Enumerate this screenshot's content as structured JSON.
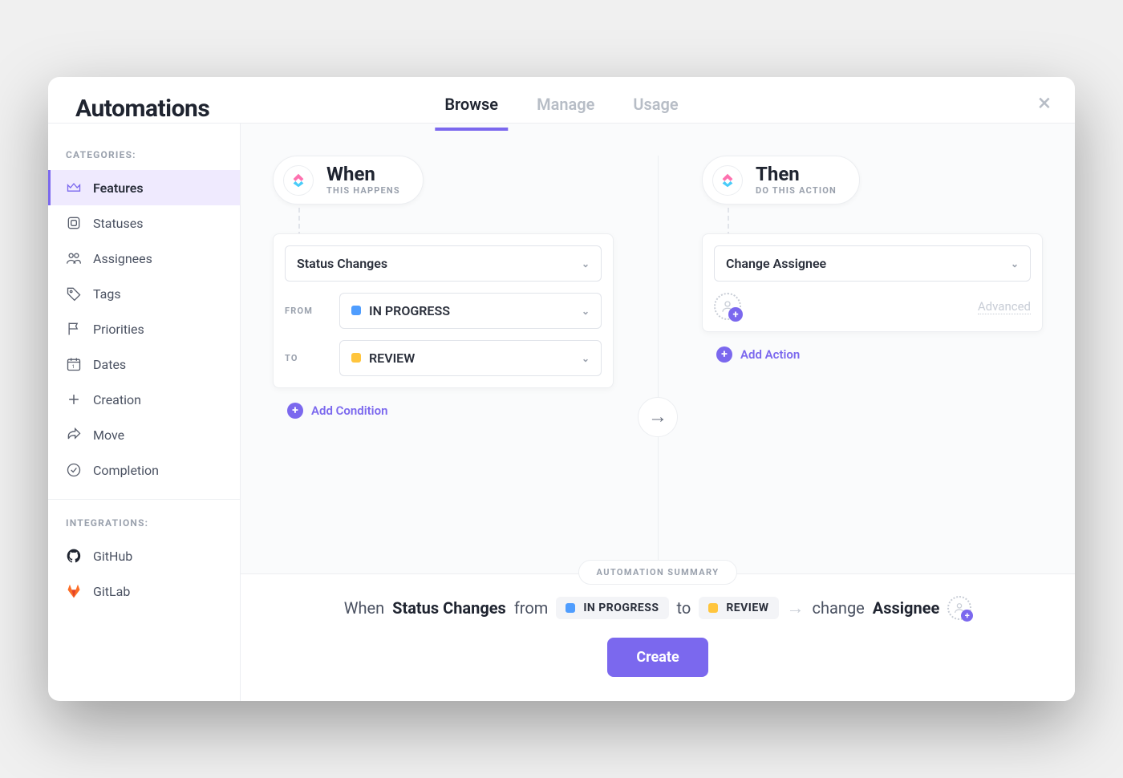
{
  "header": {
    "title": "Automations",
    "tabs": {
      "browse": "Browse",
      "manage": "Manage",
      "usage": "Usage"
    }
  },
  "sidebar": {
    "categories_label": "CATEGORIES:",
    "integrations_label": "INTEGRATIONS:",
    "items": [
      {
        "label": "Features"
      },
      {
        "label": "Statuses"
      },
      {
        "label": "Assignees"
      },
      {
        "label": "Tags"
      },
      {
        "label": "Priorities"
      },
      {
        "label": "Dates"
      },
      {
        "label": "Creation"
      },
      {
        "label": "Move"
      },
      {
        "label": "Completion"
      }
    ],
    "integrations": [
      {
        "label": "GitHub"
      },
      {
        "label": "GitLab"
      }
    ]
  },
  "when": {
    "title": "When",
    "subtitle": "THIS HAPPENS",
    "trigger": "Status Changes",
    "from_label": "FROM",
    "to_label": "TO",
    "from_status": "IN PROGRESS",
    "to_status": "REVIEW",
    "add_condition": "Add Condition",
    "colors": {
      "in_progress": "#4F9DFE",
      "review": "#FFC53D"
    }
  },
  "then": {
    "title": "Then",
    "subtitle": "DO THIS ACTION",
    "action": "Change Assignee",
    "advanced": "Advanced",
    "add_action": "Add Action"
  },
  "summary": {
    "pill": "AUTOMATION SUMMARY",
    "when_word": "When",
    "trigger": "Status Changes",
    "from_word": "from",
    "from_status": "IN PROGRESS",
    "to_word": "to",
    "to_status": "REVIEW",
    "change_word": "change",
    "target": "Assignee",
    "create_button": "Create"
  }
}
